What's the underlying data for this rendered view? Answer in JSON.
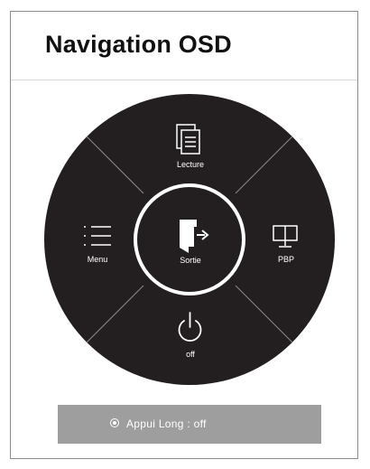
{
  "title": "Navigation OSD",
  "wheel": {
    "top": {
      "label": "Lecture",
      "icon": "document-icon"
    },
    "left": {
      "label": "Menu",
      "icon": "menu-list-icon"
    },
    "center": {
      "label": "Sortie",
      "icon": "exit-door-icon"
    },
    "right": {
      "label": "PBP",
      "icon": "dual-monitor-icon"
    },
    "bottom": {
      "label": "off",
      "icon": "power-icon"
    }
  },
  "status_bar": {
    "icon": "radio-selected-icon",
    "text": "Appui Long : off"
  },
  "colors": {
    "wheel": "#231f20",
    "status_bar": "#9e9e9e",
    "frame": "#8c8c8c"
  }
}
